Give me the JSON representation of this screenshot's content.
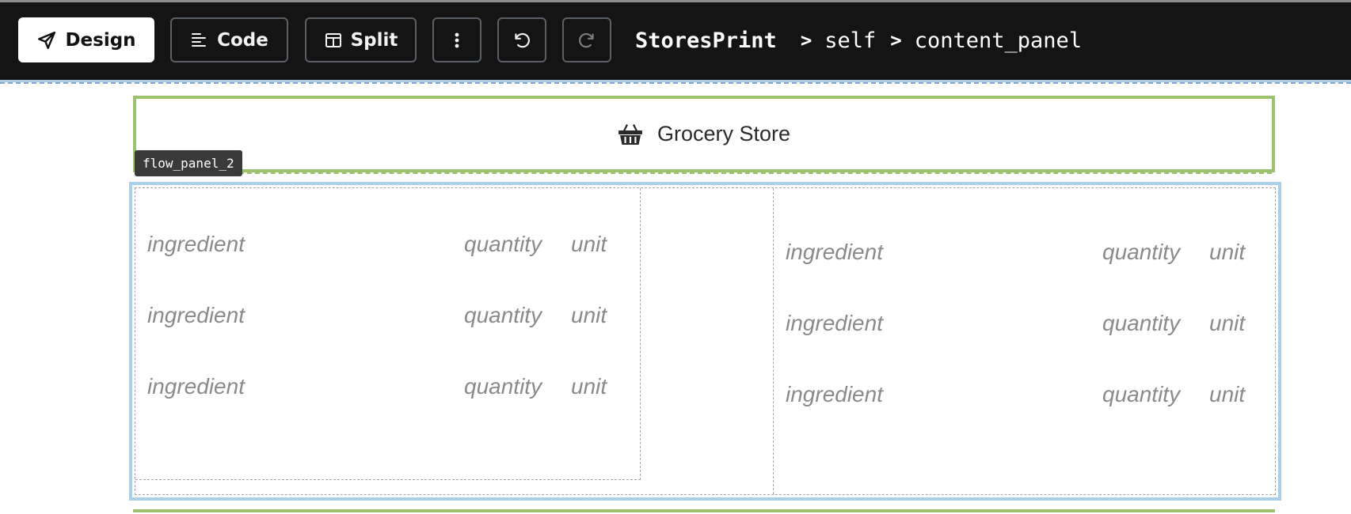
{
  "toolbar": {
    "design_label": "Design",
    "code_label": "Code",
    "split_label": "Split",
    "icons": {
      "design": "send-icon",
      "code": "align-left-icon",
      "split": "split-view-icon",
      "more": "more-vertical-icon",
      "undo": "undo-icon",
      "redo": "redo-icon"
    }
  },
  "breadcrumb": {
    "root": "StoresPrint",
    "separator": ">",
    "items": [
      "self",
      "content_panel"
    ]
  },
  "header": {
    "icon": "basket-icon",
    "title": "Grocery Store",
    "panel_tag": "flow_panel_2"
  },
  "content": {
    "left_rows": [
      {
        "ingredient": "ingredient",
        "quantity": "quantity",
        "unit": "unit"
      },
      {
        "ingredient": "ingredient",
        "quantity": "quantity",
        "unit": "unit"
      },
      {
        "ingredient": "ingredient",
        "quantity": "quantity",
        "unit": "unit"
      }
    ],
    "right_rows": [
      {
        "ingredient": "ingredient",
        "quantity": "quantity",
        "unit": "unit"
      },
      {
        "ingredient": "ingredient",
        "quantity": "quantity",
        "unit": "unit"
      },
      {
        "ingredient": "ingredient",
        "quantity": "quantity",
        "unit": "unit"
      }
    ]
  },
  "colors": {
    "toolbar_bg": "#141414",
    "panel_green": "#9dc26d",
    "panel_blue": "#a9d0ea",
    "placeholder_text": "#8a8a8a"
  }
}
